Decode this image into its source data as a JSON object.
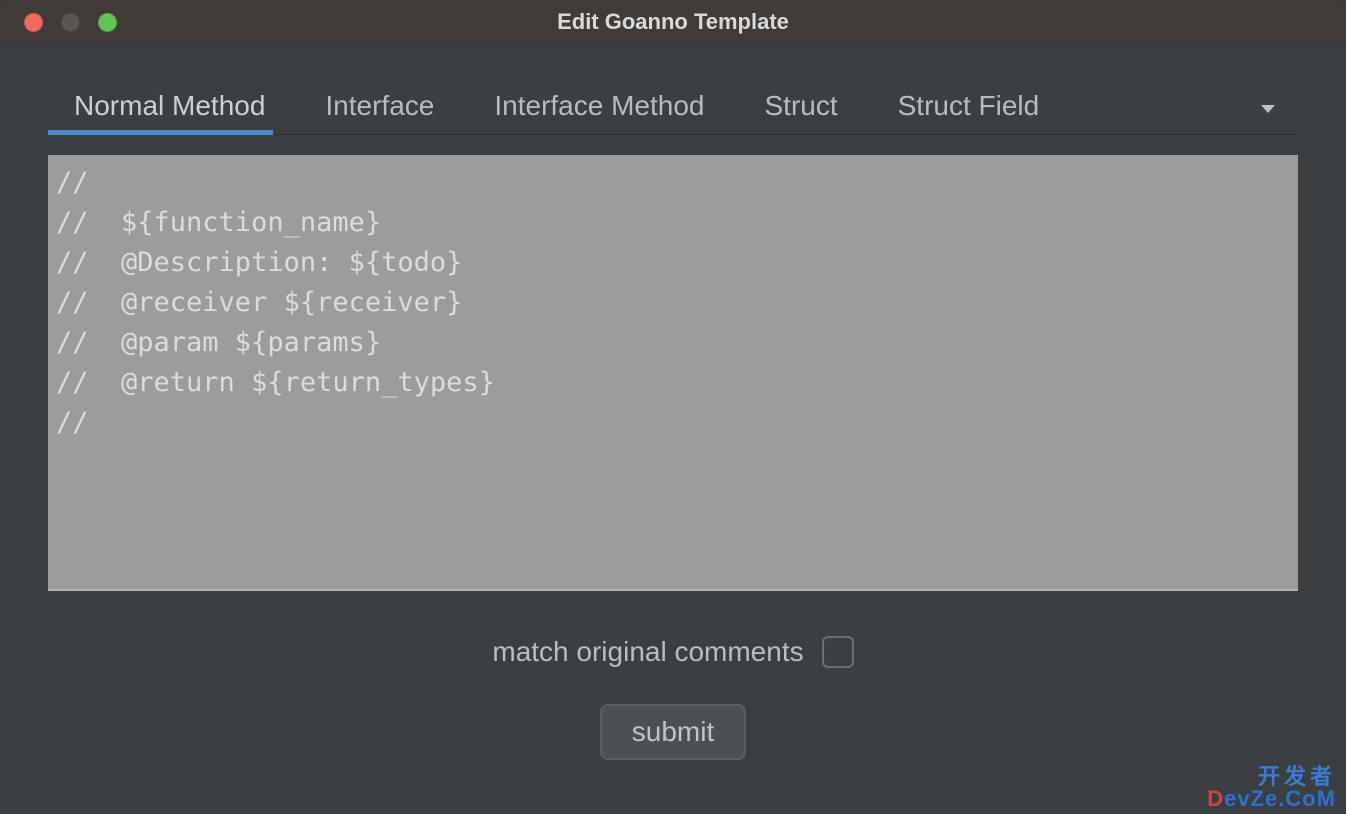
{
  "window": {
    "title": "Edit Goanno Template"
  },
  "tabs": {
    "items": [
      {
        "label": "Normal Method",
        "active": true
      },
      {
        "label": "Interface",
        "active": false
      },
      {
        "label": "Interface Method",
        "active": false
      },
      {
        "label": "Struct",
        "active": false
      },
      {
        "label": "Struct Field",
        "active": false
      }
    ]
  },
  "editor": {
    "value": "//\n//  ${function_name}\n//  @Description: ${todo}\n//  @receiver ${receiver}\n//  @param ${params}\n//  @return ${return_types}\n//"
  },
  "options": {
    "match_label": "match original comments",
    "match_checked": false
  },
  "actions": {
    "submit_label": "submit"
  },
  "watermark": {
    "line1": "开发者",
    "line2_d": "D",
    "line2_rest": "evZe.CoM"
  }
}
